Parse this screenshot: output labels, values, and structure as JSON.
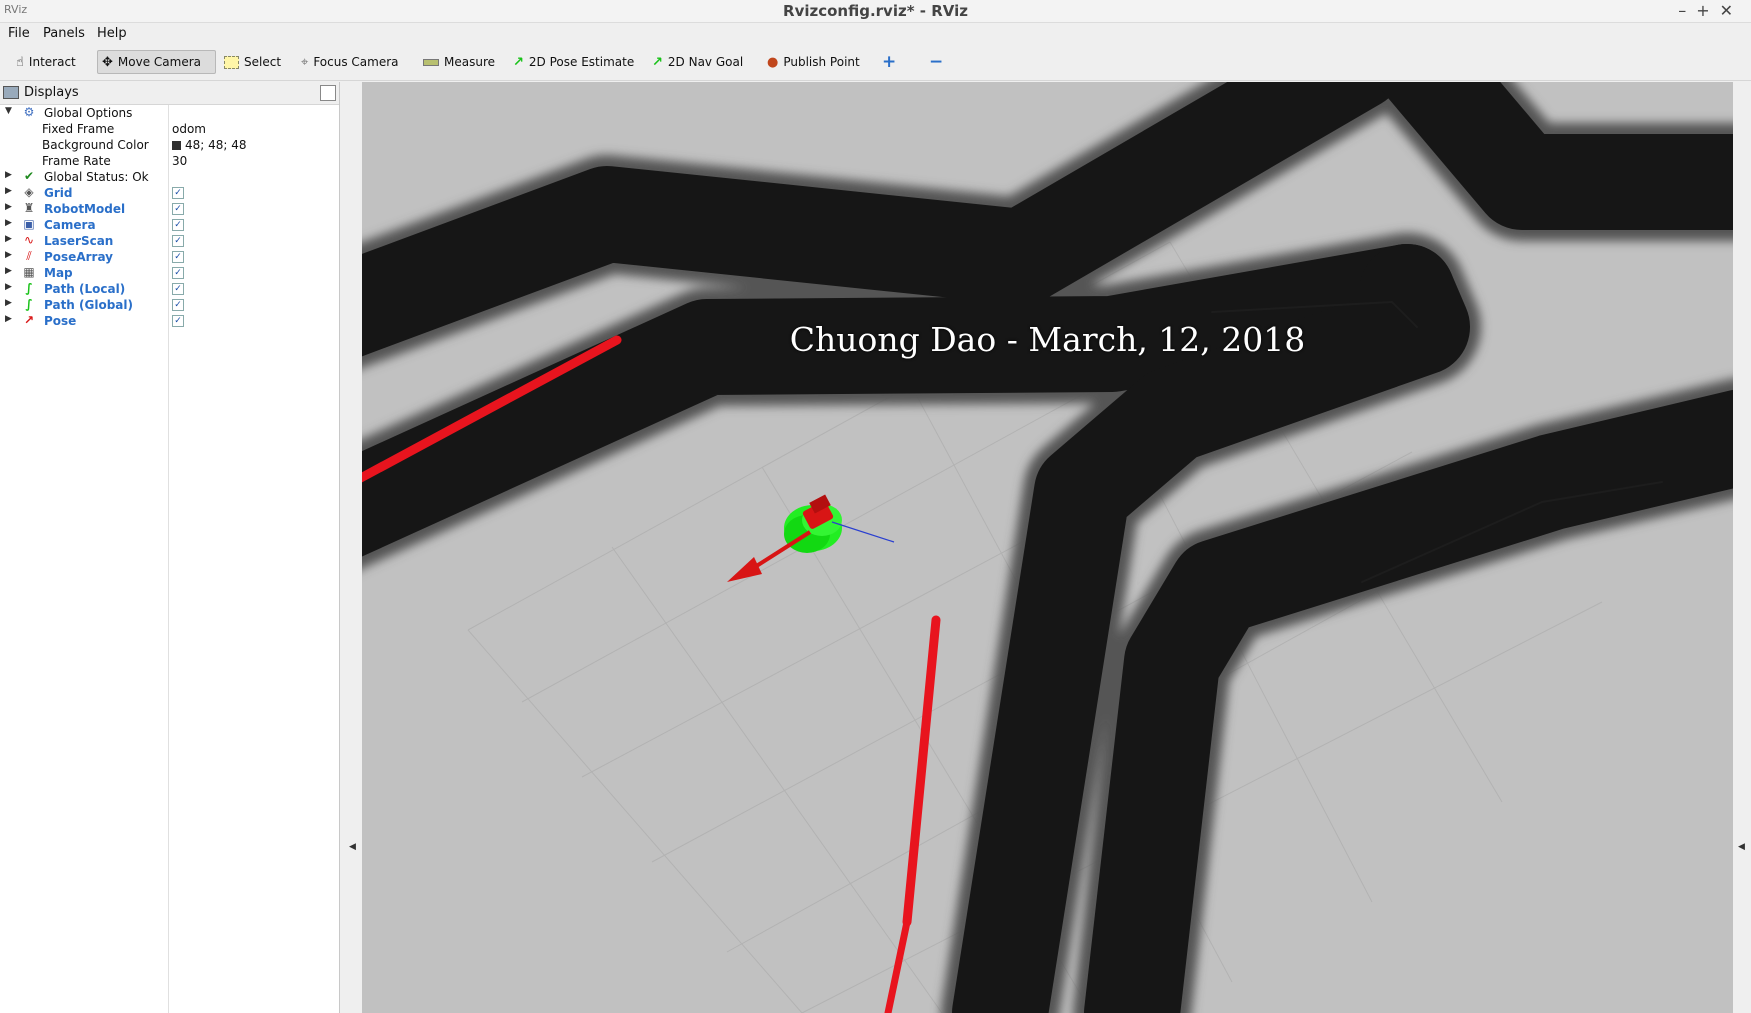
{
  "window": {
    "title": "Rvizconfig.rviz* - RViz",
    "controls": [
      "–",
      "+",
      "✕"
    ]
  },
  "menu": [
    "File",
    "Panels",
    "Help"
  ],
  "toolbar": {
    "tools": [
      {
        "label": "Interact",
        "icon": "hand-pointer-icon",
        "active": false
      },
      {
        "label": "Move Camera",
        "icon": "move-arrows-icon",
        "active": true
      },
      {
        "label": "Select",
        "icon": "selection-box-icon",
        "active": false
      },
      {
        "label": "Focus Camera",
        "icon": "crosshair-icon",
        "active": false
      },
      {
        "label": "Measure",
        "icon": "ruler-icon",
        "active": false
      },
      {
        "label": "2D Pose Estimate",
        "icon": "green-arrow-icon",
        "active": false
      },
      {
        "label": "2D Nav Goal",
        "icon": "green-arrow-icon",
        "active": false
      },
      {
        "label": "Publish Point",
        "icon": "map-pin-icon",
        "active": false
      }
    ],
    "add_tool": "+",
    "remove_tool": "−"
  },
  "displays_panel": {
    "title": "Displays",
    "global_options": {
      "label": "Global Options",
      "fixed_frame_label": "Fixed Frame",
      "fixed_frame_value": "odom",
      "background_color_label": "Background Color",
      "background_color_value": "48; 48; 48",
      "frame_rate_label": "Frame Rate",
      "frame_rate_value": "30"
    },
    "global_status": "Global Status: Ok",
    "displays": [
      {
        "name": "Grid",
        "icon": "grid-icon",
        "enabled": true
      },
      {
        "name": "RobotModel",
        "icon": "robot-icon",
        "enabled": true
      },
      {
        "name": "Camera",
        "icon": "camera-icon",
        "enabled": true
      },
      {
        "name": "LaserScan",
        "icon": "laser-scan-icon",
        "enabled": true
      },
      {
        "name": "PoseArray",
        "icon": "pose-array-icon",
        "enabled": true
      },
      {
        "name": "Map",
        "icon": "map-icon",
        "enabled": true
      },
      {
        "name": "Path (Local)",
        "icon": "path-icon",
        "enabled": true
      },
      {
        "name": "Path (Global)",
        "icon": "path-icon",
        "enabled": true
      },
      {
        "name": "Pose",
        "icon": "pose-arrow-icon",
        "enabled": true
      }
    ]
  },
  "viewport": {
    "overlay_text": "Chuong Dao - March, 12, 2018",
    "colors": {
      "background": "#c1c1c1",
      "obstacle": "#161616",
      "inflation": "#4a4a4a",
      "path": "#e8141e",
      "particles": "#22ee22",
      "robot": "#d81515",
      "heading": "#2a3fd0"
    }
  }
}
